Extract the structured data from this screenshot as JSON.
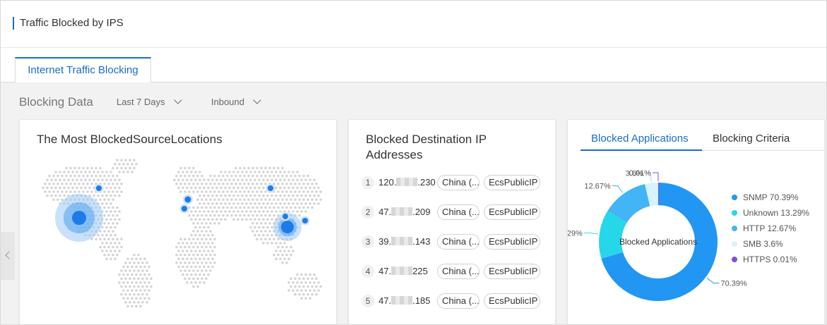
{
  "header": {
    "title": "Traffic Blocked by IPS"
  },
  "tabs": [
    {
      "label": "Internet Traffic Blocking",
      "active": true
    }
  ],
  "filters": {
    "label": "Blocking Data",
    "period": "Last 7 Days",
    "direction": "Inbound"
  },
  "map_card": {
    "title": "The Most BlockedSourceLocations"
  },
  "ip_card": {
    "title": "Blocked Destination IP Addresses",
    "rows": [
      {
        "index": "1",
        "ip_prefix": "120.",
        "ip_suffix": ".230",
        "location": "China (...",
        "type": "EcsPublicIP"
      },
      {
        "index": "2",
        "ip_prefix": "47.",
        "ip_suffix": ".209",
        "location": "China (...",
        "type": "EcsPublicIP"
      },
      {
        "index": "3",
        "ip_prefix": "39.",
        "ip_suffix": ".143",
        "location": "China (...",
        "type": "EcsPublicIP"
      },
      {
        "index": "4",
        "ip_prefix": "47.",
        "ip_suffix": "225",
        "location": "China (...",
        "type": "EcsPublicIP"
      },
      {
        "index": "5",
        "ip_prefix": "47.",
        "ip_suffix": ".185",
        "location": "China (...",
        "type": "EcsPublicIP"
      }
    ]
  },
  "app_card": {
    "tab_active": "Blocked Applications",
    "tab_inactive": "Blocking Criteria",
    "center_label": "Blocked Applications",
    "slices": [
      {
        "name": "SNMP",
        "value": 70.39,
        "label": "70.39%",
        "legend": "SNMP 70.39%",
        "color": "#2196f3"
      },
      {
        "name": "Unknown",
        "value": 13.29,
        "label": ".29%",
        "legend": "Unknown 13.29%",
        "color": "#26d7ea"
      },
      {
        "name": "HTTP",
        "value": 12.67,
        "label": "12.67%",
        "legend": "HTTP 12.67%",
        "color": "#43b4f5"
      },
      {
        "name": "SMB",
        "value": 3.6,
        "label": "3.6%",
        "legend": "SMB 3.6%",
        "color": "#d7f3fc"
      },
      {
        "name": "HTTPS",
        "value": 0.01,
        "label": "0.01%",
        "legend": "HTTPS 0.01%",
        "color": "#7e4fe0"
      }
    ]
  }
}
